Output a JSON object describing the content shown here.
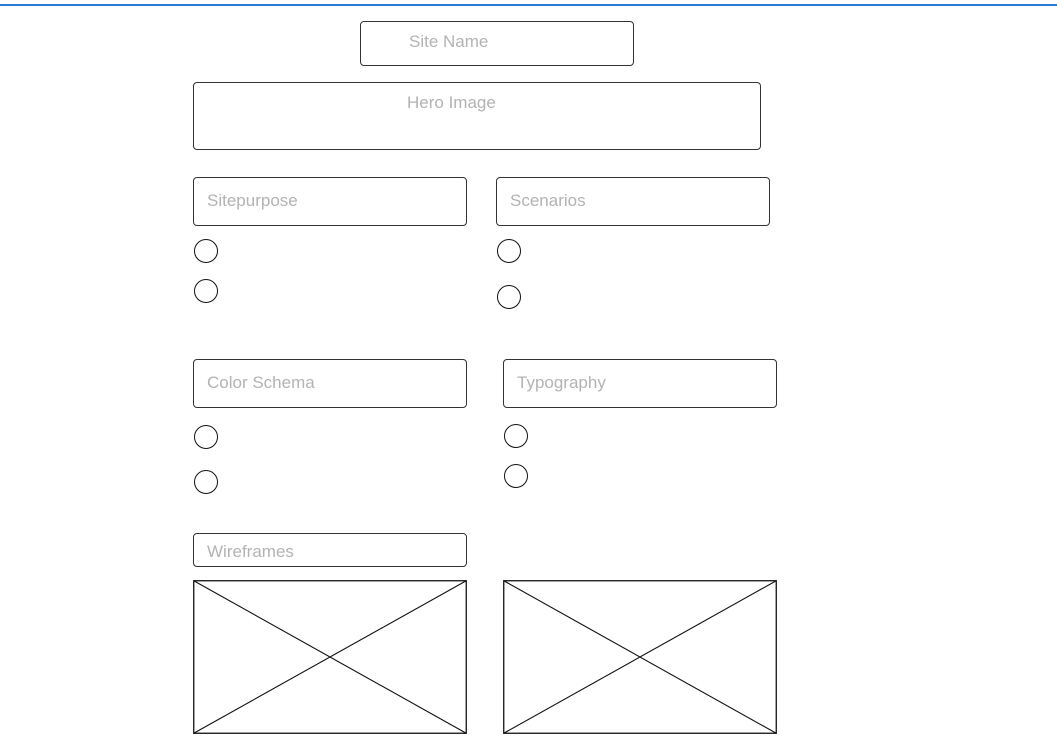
{
  "accent_color": "#2a7bd4",
  "site_name": "Site Name",
  "hero_image": "Hero Image",
  "sections": {
    "site_purpose": "Sitepurpose",
    "scenarios": "Scenarios",
    "color_schema": "Color Schema",
    "typography": "Typography",
    "wireframes": "Wireframes"
  },
  "icons": {
    "radio": "radio-button-icon",
    "image_placeholder": "image-placeholder-icon"
  }
}
